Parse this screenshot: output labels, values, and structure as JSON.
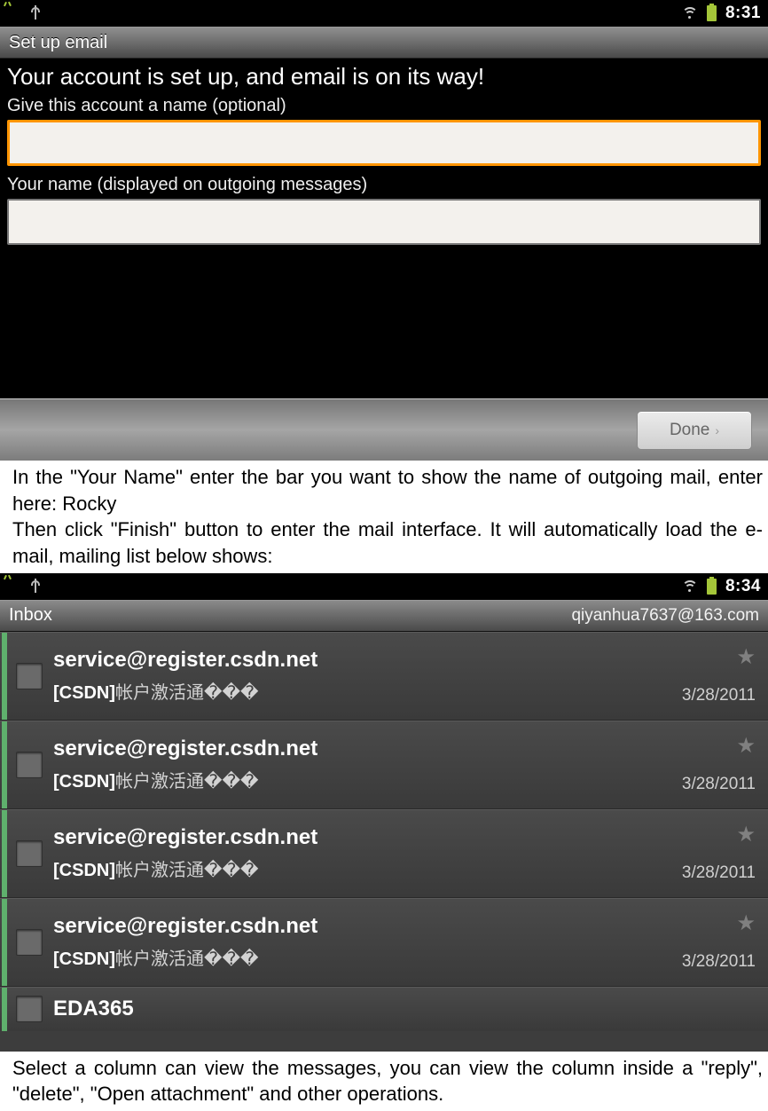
{
  "screenA": {
    "status": {
      "time": "8:31"
    },
    "title": "Set up email",
    "success": "Your account is set up, and email is on its way!",
    "account_label": "Give this account a name (optional)",
    "account_value": "",
    "yourname_label": "Your name (displayed on outgoing messages)",
    "yourname_value": "",
    "done": "Done"
  },
  "doc1": {
    "p1": "In the \"Your Name\" enter the bar you want to show the name of outgoing mail, enter here: Rocky",
    "p2": "Then click \"Finish\" button to enter the mail interface. It will automatically load the e-mail, mailing list below shows:"
  },
  "screenB": {
    "status": {
      "time": "8:34"
    },
    "folder": "Inbox",
    "account": "qiyanhua7637@163.com",
    "rows": [
      {
        "sender": "service@register.csdn.net",
        "subject_prefix": "[CSDN]",
        "subject_rest": "帐户激活通���",
        "date": "3/28/2011"
      },
      {
        "sender": "service@register.csdn.net",
        "subject_prefix": "[CSDN]",
        "subject_rest": "帐户激活通���",
        "date": "3/28/2011"
      },
      {
        "sender": "service@register.csdn.net",
        "subject_prefix": "[CSDN]",
        "subject_rest": "帐户激活通���",
        "date": "3/28/2011"
      },
      {
        "sender": "service@register.csdn.net",
        "subject_prefix": "[CSDN]",
        "subject_rest": "帐户激活通���",
        "date": "3/28/2011"
      }
    ],
    "partial_sender": "EDA365"
  },
  "doc2": {
    "p1": "Select a column can view the messages, you can view the column inside a \"reply\", \"delete\", \"Open attachment\" and other operations."
  }
}
